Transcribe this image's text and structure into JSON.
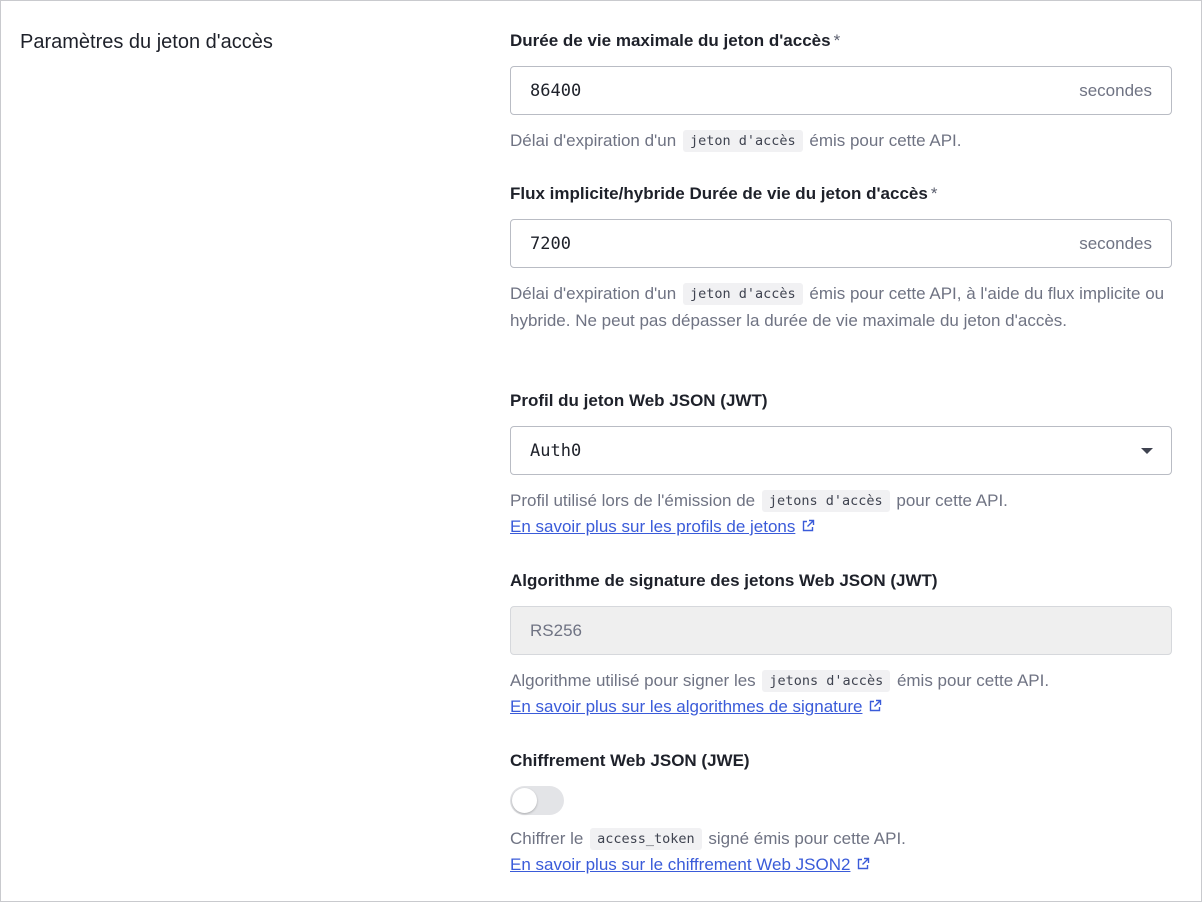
{
  "section": {
    "title": "Paramètres du jeton d'accès"
  },
  "fields": {
    "max_lifetime": {
      "label": "Durée de vie maximale du jeton d'accès",
      "required_mark": "*",
      "value": "86400",
      "suffix": "secondes",
      "help_before": "Délai d'expiration d'un",
      "help_code": "jeton d'accès",
      "help_after": "émis pour cette API."
    },
    "implicit_lifetime": {
      "label": "Flux implicite/hybride Durée de vie du jeton d'accès",
      "required_mark": "*",
      "value": "7200",
      "suffix": "secondes",
      "help_before": "Délai d'expiration d'un",
      "help_code": "jeton d'accès",
      "help_after": "émis pour cette API, à l'aide du flux implicite ou hybride. Ne peut pas dépasser la durée de vie maximale du jeton d'accès."
    },
    "jwt_profile": {
      "label": "Profil du jeton Web JSON (JWT)",
      "value": "Auth0",
      "help_before": "Profil utilisé lors de l'émission de",
      "help_code": "jetons d'accès",
      "help_after": "pour cette API.",
      "link": "En savoir plus sur les profils de jetons"
    },
    "signing_algorithm": {
      "label": "Algorithme de signature des jetons Web JSON (JWT)",
      "value": "RS256",
      "help_before": "Algorithme utilisé pour signer les",
      "help_code": "jetons d'accès",
      "help_after": "émis pour cette API.",
      "link": "En savoir plus sur les algorithmes de signature"
    },
    "jwe": {
      "label": "Chiffrement Web JSON (JWE)",
      "enabled": false,
      "help_before": "Chiffrer le",
      "help_code": "access_token",
      "help_after": "signé émis pour cette API.",
      "link": "En savoir plus sur le chiffrement Web JSON2"
    }
  },
  "colors": {
    "link": "#3a5bd9",
    "muted_text": "#6f7383",
    "border": "#b9bcc4",
    "disabled_bg": "#efefef"
  },
  "icons": {
    "external_link": "external-link-icon",
    "dropdown": "chevron-down-icon"
  }
}
